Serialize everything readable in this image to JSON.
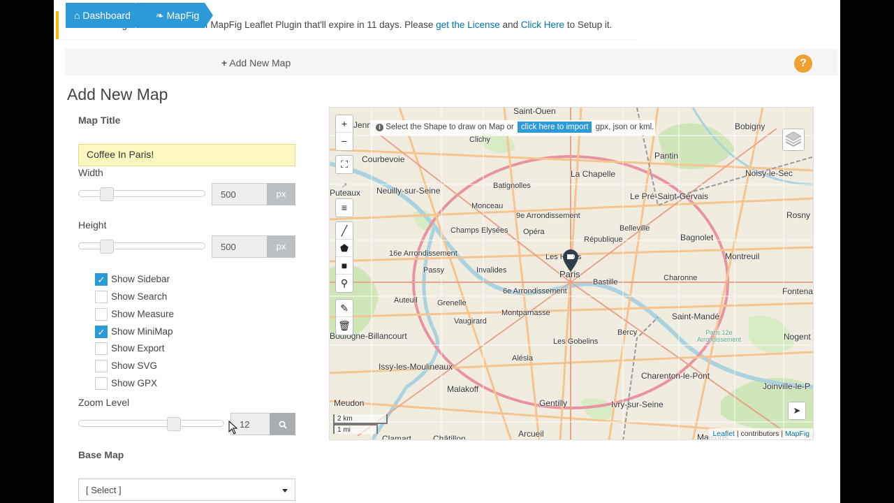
{
  "notice": {
    "prefix": "You are using the Trial Version of MapFig Leaflet Plugin that'll expire in 11 days. Please",
    "license_link": "get the License",
    "middle": "and",
    "setup_link": "Click Here",
    "suffix": "to Setup it."
  },
  "breadcrumb": {
    "dashboard": "Dashboard",
    "mapfig": "MapFig",
    "current": "Add New Map"
  },
  "help": {
    "label": "?"
  },
  "page_title": "Add New Map",
  "form": {
    "map_title_label": "Map Title",
    "map_title_value": "Coffee In Paris!",
    "width_label": "Width",
    "width_value": "500",
    "width_unit": "px",
    "height_label": "Height",
    "height_value": "500",
    "height_unit": "px",
    "checkboxes": [
      {
        "label": "Show Sidebar",
        "checked": true
      },
      {
        "label": "Show Search",
        "checked": false
      },
      {
        "label": "Show Measure",
        "checked": false
      },
      {
        "label": "Show MiniMap",
        "checked": true
      },
      {
        "label": "Show Export",
        "checked": false
      },
      {
        "label": "Show SVG",
        "checked": false
      },
      {
        "label": "Show GPX",
        "checked": false
      }
    ],
    "zoom_label": "Zoom Level",
    "zoom_value": "12",
    "base_map_label": "Base Map",
    "base_map_selected": "[ Select ]"
  },
  "map": {
    "import_hint_prefix": "Select the Shape to draw on Map or",
    "import_button": "click here to import",
    "import_hint_suffix": "gpx, json or kml.",
    "scale_km": "2 km",
    "scale_mi": "1 mi",
    "attribution_leaflet": "Leaflet",
    "attribution_contrib": "| contributors |",
    "attribution_mapfig": "MapFig",
    "marker_label": "Paris",
    "places": [
      "Saint-Ouen",
      "Bobigny",
      "Courbevoie",
      "Pantin",
      "Noisy-le-Sec",
      "La Chapelle",
      "Batignolles",
      "Neuilly-sur-Seine",
      "Puteaux",
      "Le Pré-Saint-Gervais",
      "Monceau",
      "9e Arrondissement",
      "Champs Elysées",
      "Opéra",
      "Belleville",
      "Bagnolet",
      "Rosny",
      "République",
      "16e Arrondissement",
      "Les Halles",
      "Montreuil",
      "Passy",
      "Invalides",
      "Bastille",
      "Charonne",
      "Auteuil",
      "6e Arrondissement",
      "Fontenay-s",
      "Grenelle",
      "Montparnasse",
      "Saint-Mandé",
      "Vaugirard",
      "Bercy",
      "Paris 12e Arrondissement",
      "Nogent",
      "Boulogne-Billancourt",
      "Les Gobelins",
      "Alésia",
      "Issy-les-Moulineaux",
      "Charenton-le-Pont",
      "Joinville-le-P",
      "Malakoff",
      "Meudon",
      "Gentilly",
      "Ivry-sur-Seine",
      "Clamart",
      "Châtillon",
      "Arcueil",
      "Maisons",
      "Jenne",
      "Clichy"
    ]
  },
  "colors": {
    "accent": "#2d9ad8",
    "notice_border": "#ffba00",
    "title_input_bg": "#fcf8c0",
    "help": "#f0a030"
  },
  "icons": [
    "home-icon",
    "leaf-icon",
    "plus-icon",
    "help-icon",
    "search-icon",
    "info-icon",
    "layers-icon",
    "locate-icon",
    "marker-cup-icon"
  ]
}
